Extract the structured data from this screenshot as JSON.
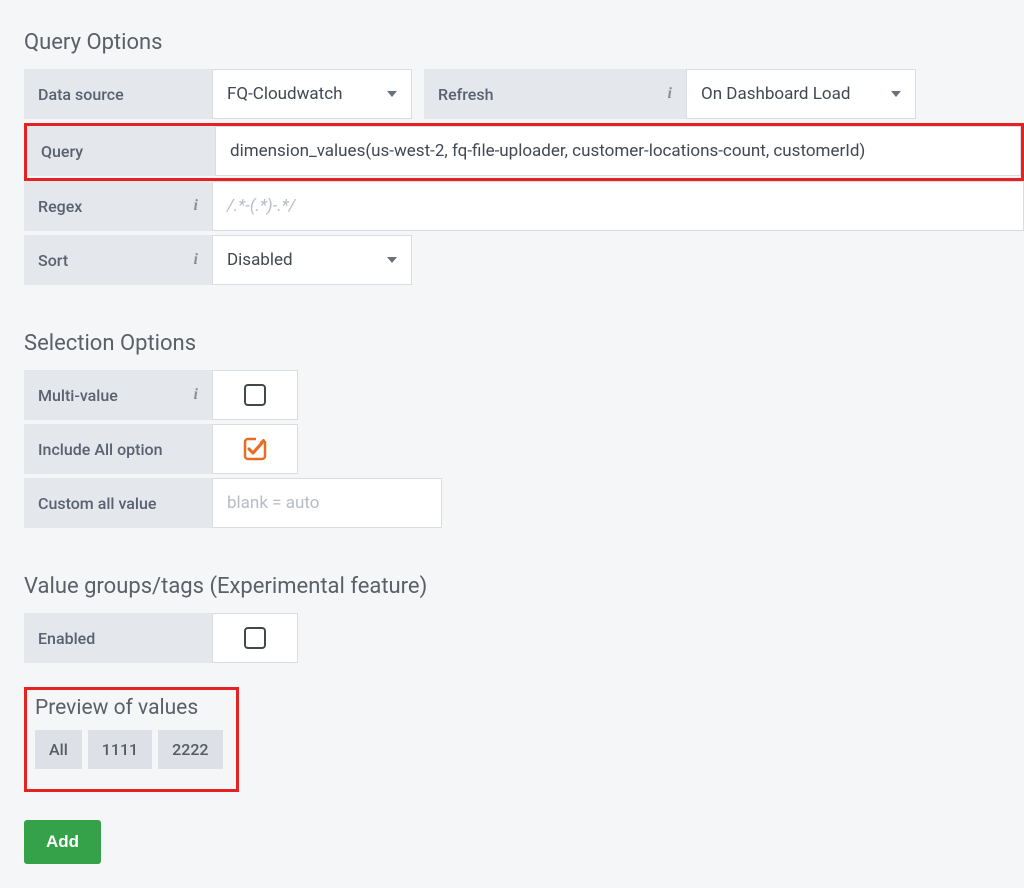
{
  "sections": {
    "queryOptions": "Query Options",
    "selectionOptions": "Selection Options",
    "valueGroups": "Value groups/tags (Experimental feature)",
    "preview": "Preview of values"
  },
  "labels": {
    "dataSource": "Data source",
    "refresh": "Refresh",
    "query": "Query",
    "regex": "Regex",
    "sort": "Sort",
    "multiValue": "Multi-value",
    "includeAll": "Include All option",
    "customAll": "Custom all value",
    "enabled": "Enabled"
  },
  "values": {
    "dataSource": "FQ-Cloudwatch",
    "refresh": "On Dashboard Load",
    "query": "dimension_values(us-west-2, fq-file-uploader, customer-locations-count, customerId)",
    "regexPlaceholder": "/.*-(.*)-.*/",
    "sort": "Disabled",
    "customAllPlaceholder": "blank = auto",
    "multiValueChecked": false,
    "includeAllChecked": true,
    "valueGroupsEnabled": false
  },
  "preview": [
    "All",
    "1111",
    "2222"
  ],
  "buttons": {
    "add": "Add"
  }
}
